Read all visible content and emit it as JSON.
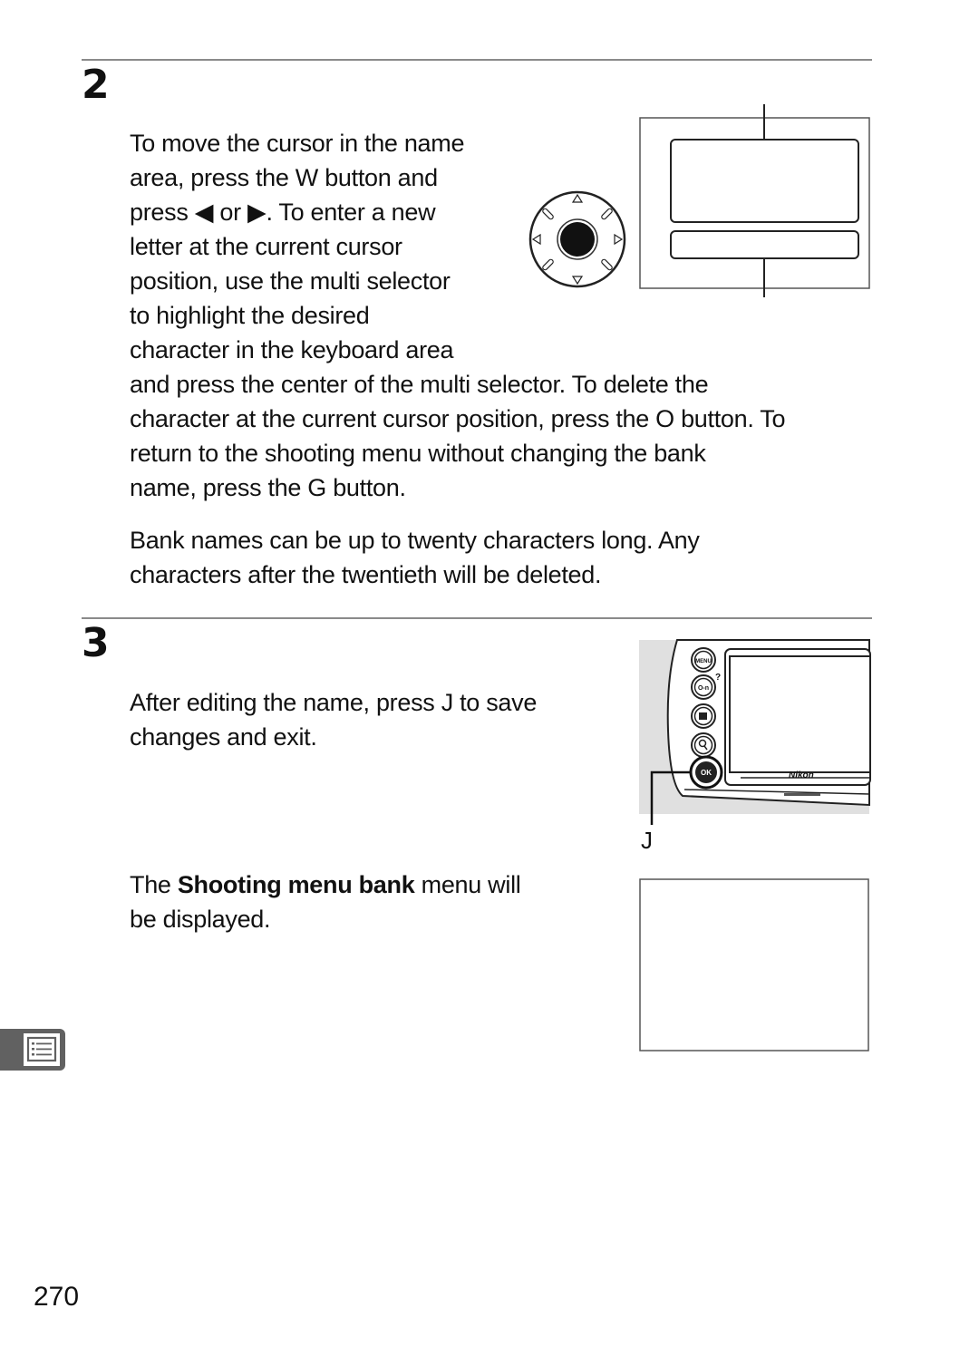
{
  "step2": {
    "number": "2",
    "para1": {
      "lines": [
        "To move the cursor in the name",
        "area, press the W   button and",
        "press ◀ or ▶.  To enter a new",
        "letter at the current cursor",
        "position, use the multi selector",
        "to highlight the desired",
        "character in the keyboard area"
      ],
      "lines_full": [
        "and press the center of the multi selector.  To delete the",
        "character at the current cursor position, press the O button.  To",
        "return to the shooting menu without changing the bank",
        "name, press the G     button."
      ]
    },
    "para2": {
      "lines": [
        "Bank names can be up to twenty characters long.  Any",
        "characters after the twentieth will be deleted."
      ]
    }
  },
  "step3": {
    "number": "3",
    "para1": {
      "lines": [
        "After editing the name, press J   to save",
        "changes and exit."
      ]
    },
    "para2": {
      "prefix": "The ",
      "bold": "Shooting menu bank",
      "suffix": " menu will",
      "line2": "be displayed."
    },
    "ok_label": "J",
    "camera_buttons": [
      "MENU",
      "O-n",
      "Q",
      "zoom",
      "OK"
    ],
    "camera_brand": "Nikon"
  },
  "page_number": "270"
}
